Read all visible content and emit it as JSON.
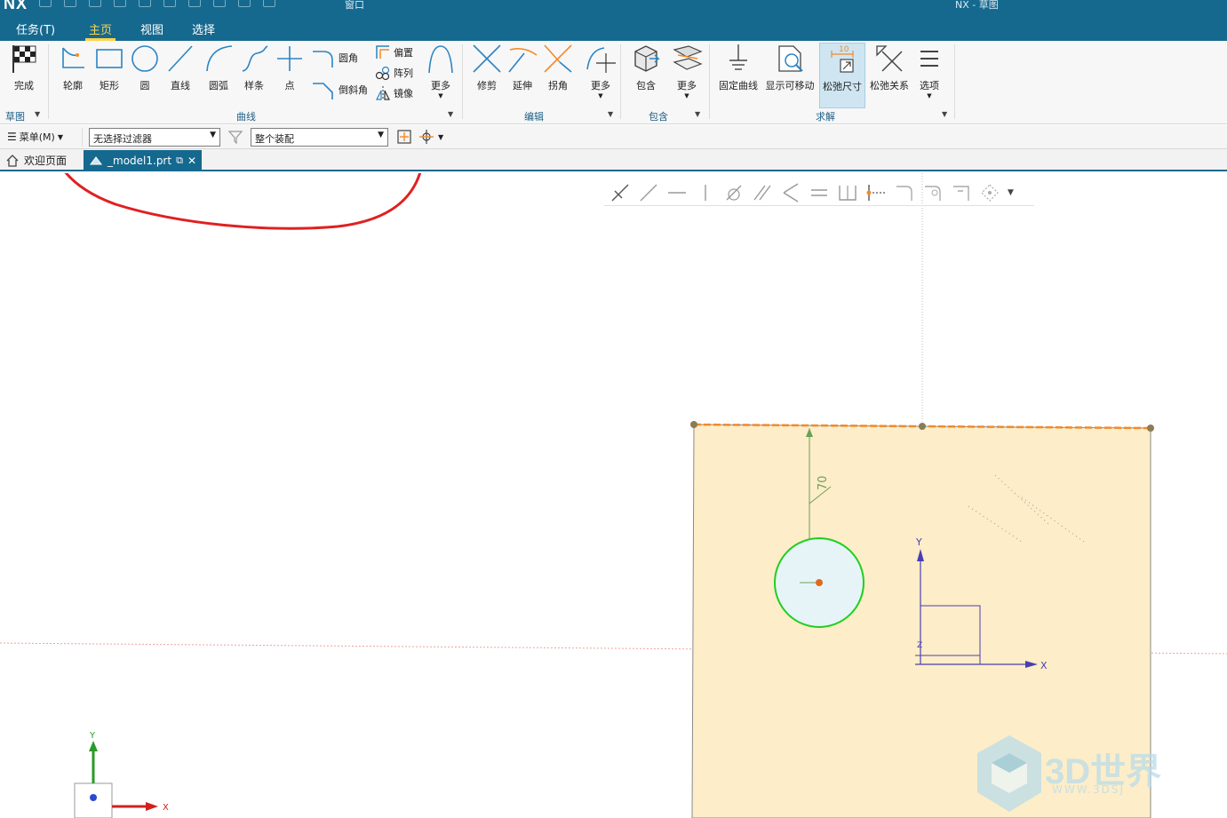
{
  "app": {
    "logo": "NX",
    "window_title": "NX - 草图",
    "window_menu": "窗口"
  },
  "ribbon_tabs": [
    "任务(T)",
    "主页",
    "视图",
    "选择"
  ],
  "active_tab": "主页",
  "ribbon": {
    "finish": "完成",
    "sketch_group": "草图",
    "curve_buttons": [
      "轮廓",
      "矩形",
      "圆",
      "直线",
      "圆弧",
      "样条",
      "点"
    ],
    "curve_small": [
      "圆角",
      "倒斜角",
      "偏置",
      "阵列",
      "镜像"
    ],
    "curve_more": "更多",
    "curve_group": "曲线",
    "edit_buttons": [
      "修剪",
      "延伸",
      "拐角",
      "更多"
    ],
    "edit_group": "编辑",
    "include_buttons": [
      "包含",
      "更多"
    ],
    "include_group": "包含",
    "solve_buttons": [
      "固定曲线",
      "显示可移动",
      "松弛尺寸",
      "松弛关系",
      "选项"
    ],
    "solve_group": "求解",
    "relax_dim_badge": "10"
  },
  "selection_bar": {
    "menu_label": "菜单(M)",
    "filter_value": "无选择过滤器",
    "scope_value": "整个装配"
  },
  "doc_tabs": [
    {
      "label": "欢迎页面",
      "active": false
    },
    {
      "label": "_model1.prt",
      "active": true
    }
  ],
  "sketch": {
    "dimension_value": "70",
    "axis_x": "X",
    "axis_y": "Y",
    "axis_z": "Z"
  },
  "colors": {
    "title_bar": "#15698f",
    "active_tab_text": "#ffd44a",
    "plane_fill": "#fdedc8",
    "top_edge_orange": "#f28a2a",
    "circle_green": "#1fcf1f",
    "circle_fill": "#e6f4f8",
    "annotation_red": "#e02020",
    "dimension_green": "#6aa05a",
    "csys_blue": "#4a3fb0"
  },
  "watermark": {
    "text": "3D世界",
    "url": "WWW.3DSJ"
  }
}
